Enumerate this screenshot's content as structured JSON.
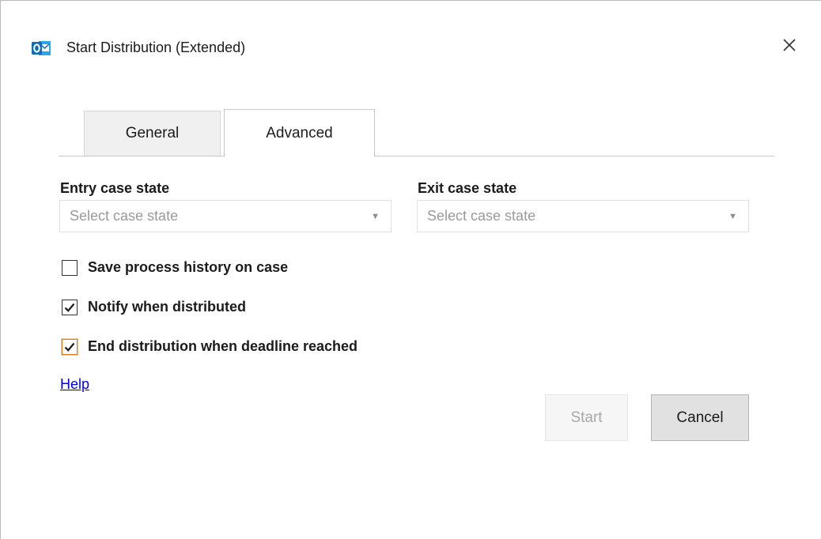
{
  "window": {
    "title": "Start Distribution (Extended)",
    "icon": "outlook-icon",
    "close_icon": "close-icon",
    "accent_color": "#0f6cbd"
  },
  "tabs": [
    {
      "label": "General",
      "selected": false
    },
    {
      "label": "Advanced",
      "selected": true
    }
  ],
  "entry_case_state": {
    "label": "Entry case state",
    "placeholder": "Select case state",
    "value": ""
  },
  "exit_case_state": {
    "label": "Exit case state",
    "placeholder": "Select case state",
    "value": ""
  },
  "options": [
    {
      "label": "Save process history on case",
      "checked": false
    },
    {
      "label": "Notify when distributed",
      "checked": true
    },
    {
      "label": "End distribution when deadline reached",
      "checked": true,
      "focused": true
    }
  ],
  "help_link": "Help",
  "buttons": {
    "start": {
      "label": "Start",
      "enabled": false
    },
    "cancel": {
      "label": "Cancel",
      "enabled": true
    }
  }
}
